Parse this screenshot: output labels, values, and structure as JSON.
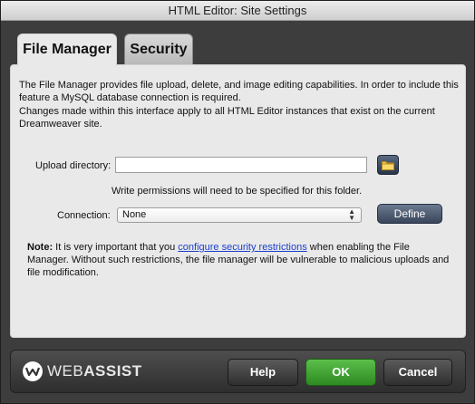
{
  "window": {
    "title": "HTML Editor: Site Settings"
  },
  "tabs": [
    {
      "label": "File Manager",
      "active": true
    },
    {
      "label": "Security",
      "active": false
    }
  ],
  "panel": {
    "intro": "The File Manager provides file upload, delete, and image editing capabilities. In order to include this feature a MySQL database connection is required.",
    "intro2": "Changes made within this interface apply to all HTML Editor instances that exist on the current Dreamweaver site.",
    "upload": {
      "label": "Upload directory:",
      "value": "",
      "placeholder": ""
    },
    "permissions_note": "Write permissions will need to be specified for this folder.",
    "connection": {
      "label": "Connection:",
      "selected": "None"
    },
    "define_label": "Define",
    "note": {
      "prefix": "Note:",
      "before_link": " It is very important that you ",
      "link": "configure security restrictions",
      "after_link": " when enabling the File Manager. Without such restrictions, the file manager will be vulnerable to malicious uploads and file modification."
    }
  },
  "footer": {
    "brand_web": "WEB",
    "brand_assist": "ASSIST",
    "help_label": "Help",
    "ok_label": "OK",
    "cancel_label": "Cancel"
  },
  "icons": {
    "folder": "folder-icon",
    "select_arrows": "updown-arrows-icon",
    "logo": "webassist-logo-icon"
  },
  "colors": {
    "ok_green": "#3aa02c",
    "link_blue": "#1a3fcc",
    "panel_bg": "#e9e9e9",
    "frame_bg": "#3d3d3d"
  }
}
